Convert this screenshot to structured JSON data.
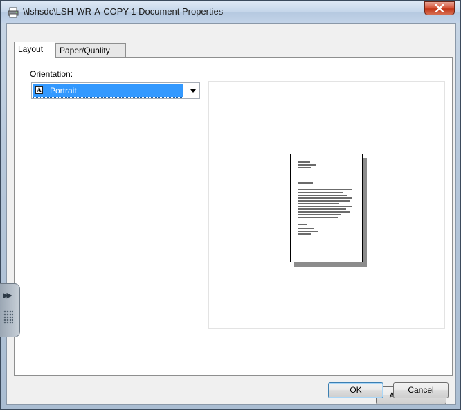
{
  "window": {
    "title": "\\\\lshsdc\\LSH-WR-A-COPY-1 Document Properties",
    "title_icon": "printer-icon",
    "close_icon": "close-icon"
  },
  "tabs": [
    {
      "label": "Layout",
      "active": true
    },
    {
      "label": "Paper/Quality",
      "active": false
    }
  ],
  "layout": {
    "orientation_label": "Orientation:",
    "orientation_value": "Portrait",
    "orientation_icon": "portrait-page-icon",
    "orientation_icon_glyph": "A"
  },
  "preview": {
    "icon": "document-page-preview"
  },
  "buttons": {
    "advanced": "Advanced...",
    "ok": "OK",
    "cancel": "Cancel"
  },
  "colors": {
    "selection": "#3399ff",
    "close_button": "#c23619",
    "dialog_bg": "#f0f0f0"
  }
}
